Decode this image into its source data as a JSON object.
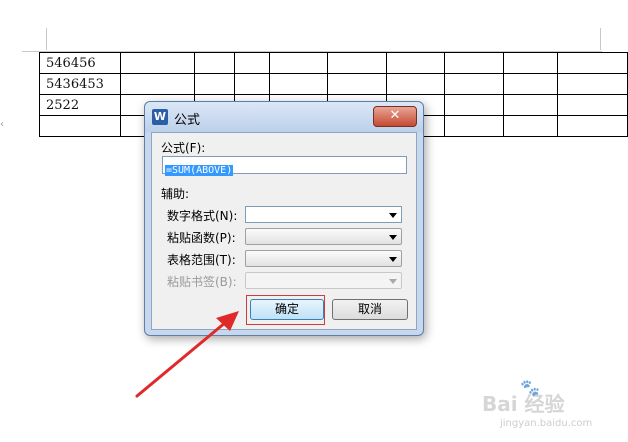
{
  "document": {
    "table_rows": [
      [
        "546456",
        "",
        "",
        "",
        "",
        "",
        "",
        "",
        "",
        ""
      ],
      [
        "5436453",
        "",
        "",
        "",
        "",
        "",
        "",
        "",
        "",
        ""
      ],
      [
        "2522",
        "",
        "",
        "",
        "",
        "",
        "",
        "",
        "",
        ""
      ],
      [
        "",
        "",
        "",
        "",
        "",
        "",
        "",
        "",
        "",
        ""
      ]
    ]
  },
  "dialog": {
    "app_icon": "W",
    "title": "公式",
    "close_label": "✕",
    "formula_label": "公式(F):",
    "formula_value": "=SUM(ABOVE)",
    "assist_label": "辅助:",
    "number_format_label": "数字格式(N):",
    "number_format_value": "",
    "paste_function_label": "粘贴函数(P):",
    "paste_function_value": "",
    "table_range_label": "表格范围(T):",
    "table_range_value": "",
    "paste_bookmark_label": "粘贴书签(B):",
    "paste_bookmark_value": "",
    "ok_label": "确定",
    "cancel_label": "取消"
  },
  "watermark": {
    "logo": "Bai 经验",
    "url": "jingyan.baidu.com"
  },
  "colors": {
    "highlight_box": "#cc3d3d",
    "arrow": "#e02a2a",
    "selection": "#3399ff"
  }
}
